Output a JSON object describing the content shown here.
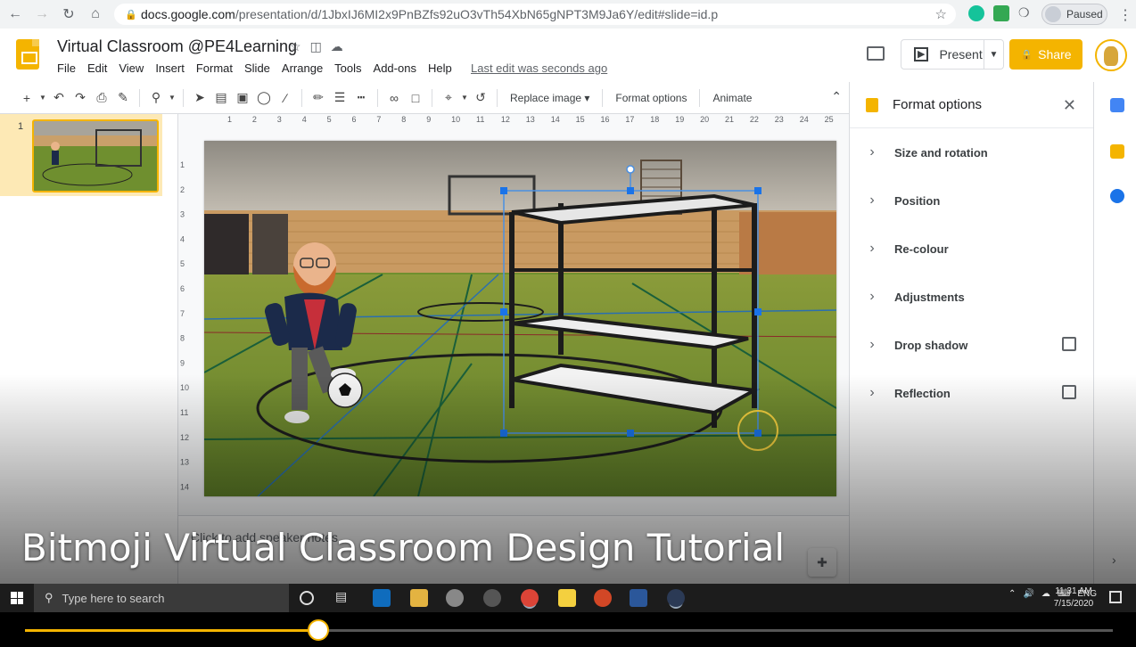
{
  "browser": {
    "url_host": "docs.google.com",
    "url_path": "/presentation/d/1JbxIJ6MI2x9PnBZfs92uO3vTh54XbN65gNPT3M9Ja6Y/edit#slide=id.p",
    "profile_status": "Paused",
    "icons": [
      "back-icon",
      "forward-icon",
      "reload-icon",
      "home-icon",
      "lock-icon",
      "star-icon",
      "extension-icon",
      "menu-icon"
    ]
  },
  "doc": {
    "title": "Virtual Classroom @PE4Learning",
    "menu": [
      "File",
      "Edit",
      "View",
      "Insert",
      "Format",
      "Slide",
      "Arrange",
      "Tools",
      "Add-ons",
      "Help"
    ],
    "last_edit": "Last edit was seconds ago",
    "present_label": "Present",
    "share_label": "Share"
  },
  "toolbar": {
    "replace_image": "Replace image",
    "format_options": "Format options",
    "animate": "Animate"
  },
  "filmstrip": {
    "slides": [
      {
        "number": "1"
      }
    ]
  },
  "rulers": {
    "horizontal": [
      "1",
      "2",
      "3",
      "4",
      "5",
      "6",
      "7",
      "8",
      "9",
      "10",
      "11",
      "12",
      "13",
      "14",
      "15",
      "16",
      "17",
      "18",
      "19",
      "20",
      "21",
      "22",
      "23",
      "24",
      "25"
    ],
    "vertical": [
      "1",
      "2",
      "3",
      "4",
      "5",
      "6",
      "7",
      "8",
      "9",
      "10",
      "11",
      "12",
      "13",
      "14"
    ]
  },
  "notes": {
    "placeholder": "Click to add speaker notes"
  },
  "format_panel": {
    "title": "Format options",
    "sections": [
      {
        "label": "Size and rotation",
        "checkbox": false
      },
      {
        "label": "Position",
        "checkbox": false
      },
      {
        "label": "Re-colour",
        "checkbox": false
      },
      {
        "label": "Adjustments",
        "checkbox": false
      },
      {
        "label": "Drop shadow",
        "checkbox": true
      },
      {
        "label": "Reflection",
        "checkbox": true
      }
    ]
  },
  "video": {
    "caption": "Bitmoji Virtual Classroom Design Tutorial",
    "progress": 0.27
  },
  "taskbar": {
    "search_placeholder": "Type here to search",
    "language": "ENG",
    "time": "11:31 AM",
    "date": "7/15/2020"
  },
  "colors": {
    "accent": "#f4b400",
    "selection": "#1a73e8",
    "court_green": "#6f8f2f"
  }
}
